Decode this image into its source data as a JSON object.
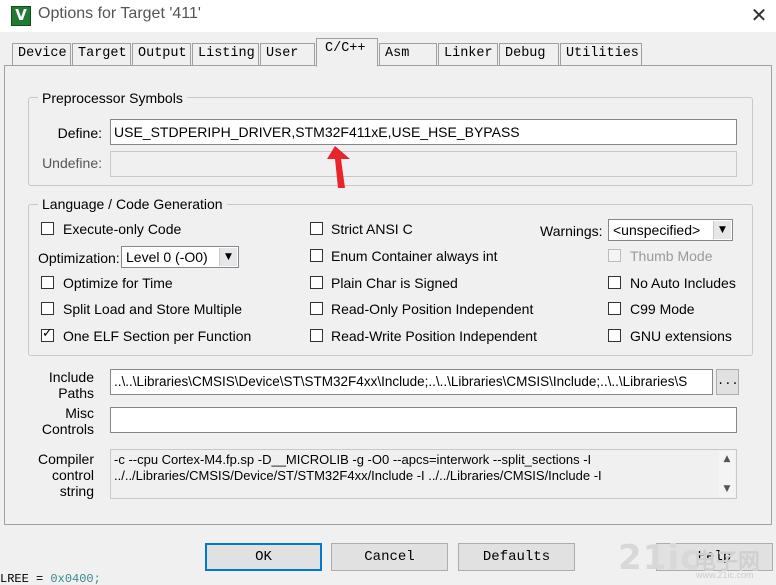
{
  "window": {
    "title": "Options for Target '411'",
    "icon": "keil-icon",
    "icon_glyph": "V",
    "close_glyph": "✕"
  },
  "tabs": [
    {
      "label": "Device",
      "active": false
    },
    {
      "label": "Target",
      "active": false
    },
    {
      "label": "Output",
      "active": false
    },
    {
      "label": "Listing",
      "active": false
    },
    {
      "label": "User",
      "active": false
    },
    {
      "label": "C/C++",
      "active": true
    },
    {
      "label": "Asm",
      "active": false
    },
    {
      "label": "Linker",
      "active": false
    },
    {
      "label": "Debug",
      "active": false
    },
    {
      "label": "Utilities",
      "active": false
    }
  ],
  "preprocessor": {
    "title": "Preprocessor Symbols",
    "define_label": "Define:",
    "define_value": "USE_STDPERIPH_DRIVER,STM32F411xE,USE_HSE_BYPASS",
    "undefine_label": "Undefine:",
    "undefine_value": ""
  },
  "language": {
    "title": "Language / Code Generation",
    "execute_only": {
      "label": "Execute-only Code",
      "checked": false
    },
    "optimization_label": "Optimization:",
    "optimization_value": "Level 0 (-O0)",
    "optimize_time": {
      "label": "Optimize for Time",
      "checked": false
    },
    "split_load_store": {
      "label": "Split Load and Store Multiple",
      "checked": false
    },
    "one_elf": {
      "label": "One ELF Section per Function",
      "checked": true
    },
    "strict_ansi": {
      "label": "Strict ANSI C",
      "checked": false
    },
    "enum_container": {
      "label": "Enum Container always int",
      "checked": false
    },
    "plain_char": {
      "label": "Plain Char is Signed",
      "checked": false
    },
    "ro_pi": {
      "label": "Read-Only Position Independent",
      "checked": false
    },
    "rw_pi": {
      "label": "Read-Write Position Independent",
      "checked": false
    },
    "warnings_label": "Warnings:",
    "warnings_value": "<unspecified>",
    "thumb_mode": {
      "label": "Thumb Mode",
      "checked": false,
      "disabled": true
    },
    "no_auto_includes": {
      "label": "No Auto Includes",
      "checked": false
    },
    "c99_mode": {
      "label": "C99 Mode",
      "checked": false
    },
    "gnu_extensions": {
      "label": "GNU extensions",
      "checked": false
    }
  },
  "include": {
    "label_line1": "Include",
    "label_line2": "Paths",
    "value": "..\\..\\Libraries\\CMSIS\\Device\\ST\\STM32F4xx\\Include;..\\..\\Libraries\\CMSIS\\Include;..\\..\\Libraries\\S",
    "browse_label": "..."
  },
  "misc": {
    "label_line1": "Misc",
    "label_line2": "Controls",
    "value": ""
  },
  "compiler": {
    "label_line1": "Compiler",
    "label_line2": "control",
    "label_line3": "string",
    "line1": "-c --cpu Cortex-M4.fp.sp -D__MICROLIB -g -O0 --apcs=interwork --split_sections -I",
    "line2": "../../Libraries/CMSIS/Device/ST/STM32F4xx/Include -I ../../Libraries/CMSIS/Include -I"
  },
  "buttons": {
    "ok": "OK",
    "cancel": "Cancel",
    "defaults": "Defaults",
    "help": "Help"
  },
  "background": {
    "code_word": "LREE",
    "code_value": "0x0400;"
  },
  "watermark": {
    "brand": "21ic",
    "cn": "电子网",
    "url": "www.21ic.com"
  },
  "colors": {
    "annotation_arrow": "#e8252b",
    "default_button_border": "#0078d7"
  }
}
